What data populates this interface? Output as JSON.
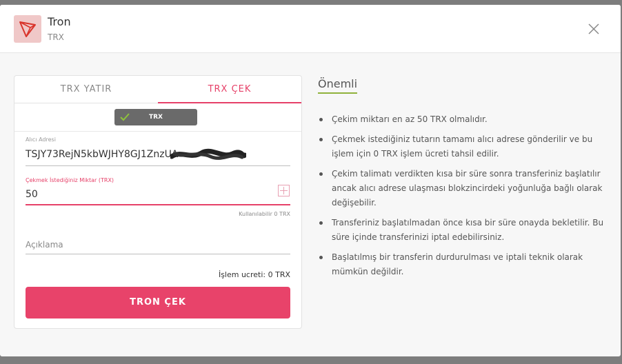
{
  "header": {
    "coin_name": "Tron",
    "coin_symbol": "TRX",
    "logo_icon": "tron-logo-icon",
    "close_icon": "close-icon"
  },
  "tabs": [
    {
      "label": "TRX YATIR",
      "active": false
    },
    {
      "label": "TRX ÇEK",
      "active": true
    }
  ],
  "network": {
    "label": "TRX",
    "selected": true
  },
  "form": {
    "address_label": "Alıcı Adresi",
    "address_value": "TSJY73RejN5kbWJHY8GJ1ZnzUA",
    "amount_label": "Çekmek İstediğiniz Miktar (TRX)",
    "amount_value": "50",
    "available": "Kullanılabilir 0 TRX",
    "description_placeholder": "Açıklama",
    "fee": "İşlem ucreti: 0 TRX",
    "submit_label": "TRON ÇEK"
  },
  "info": {
    "title": "Önemli",
    "items": [
      "Çekim miktarı en az 50 TRX olmalıdır.",
      "Çekmek istediğiniz tutarın tamamı alıcı adrese gönderilir ve bu işlem için 0 TRX işlem ücreti tahsil edilir.",
      "Çekim talimatı verdikten kısa bir süre sonra transferiniz başlatılır ancak alıcı adrese ulaşması blokzincirdeki yoğunluğa bağlı olarak değişebilir.",
      "Transferiniz başlatılmadan önce kısa bir süre onayda bekletilir. Bu süre içinde transferinizi iptal edebilirsiniz.",
      "Başlatılmış bir transferin durdurulması ve iptali teknik olarak mümkün değildir."
    ]
  },
  "colors": {
    "accent": "#e8436a",
    "title_underline": "#8fb13b",
    "check": "#8fc33b"
  }
}
